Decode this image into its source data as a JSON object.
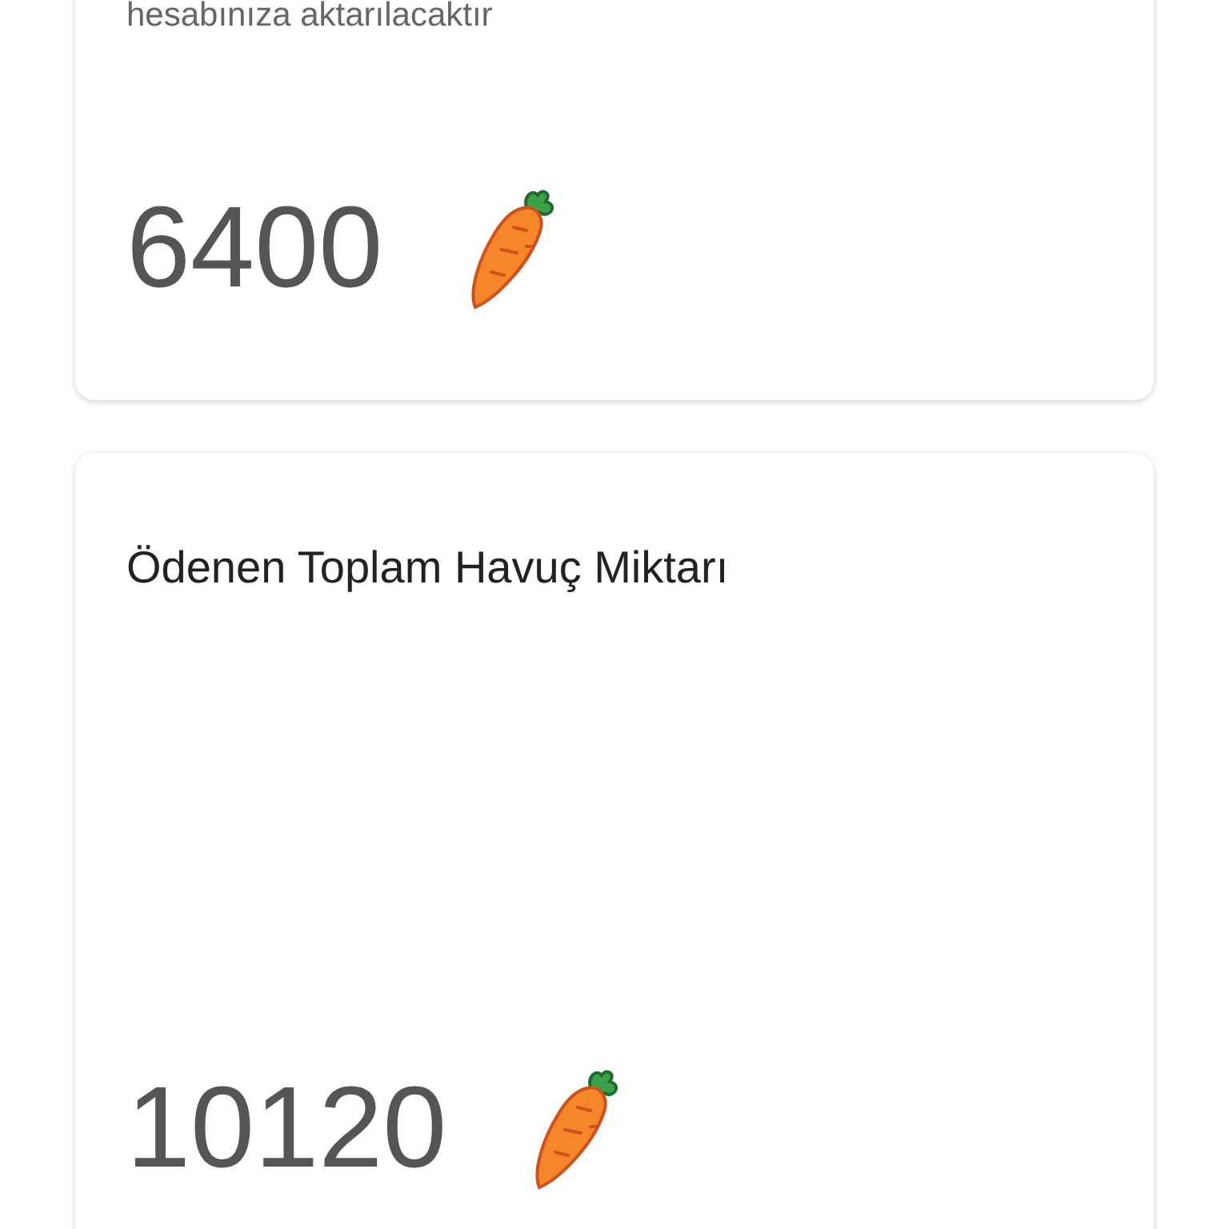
{
  "cards": [
    {
      "note": "hesabınıza aktarılacaktır",
      "amount": "6400"
    },
    {
      "title": "Ödenen Toplam Havuç Miktarı",
      "amount": "10120"
    }
  ]
}
